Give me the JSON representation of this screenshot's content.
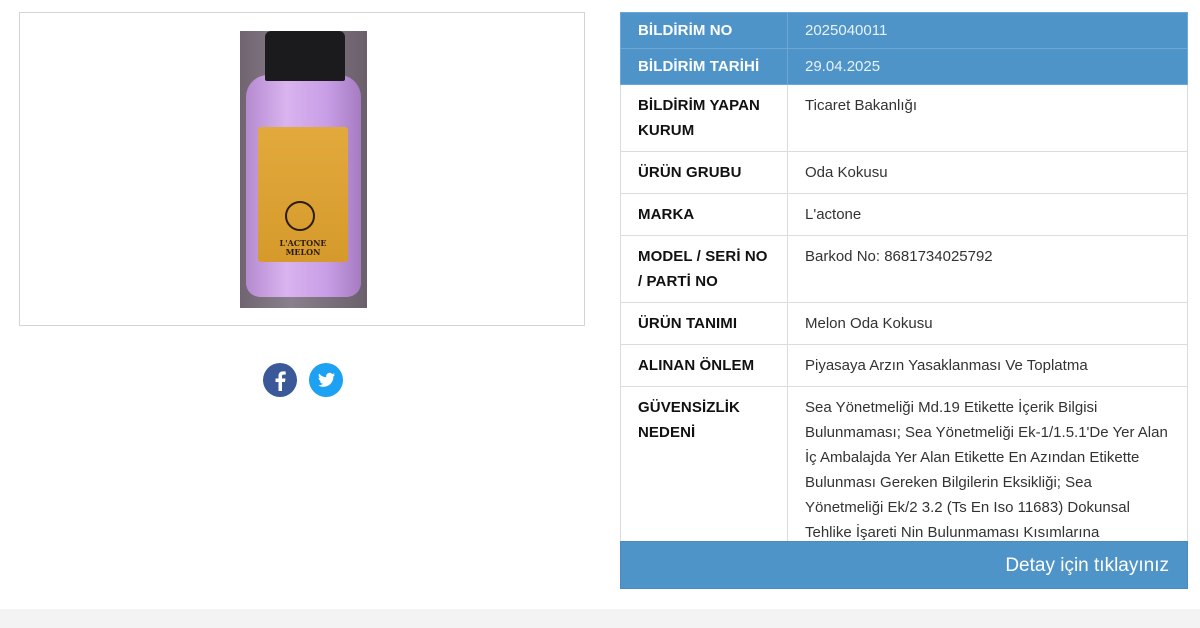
{
  "product_image": {
    "label_lines": [
      "L'ACTONE",
      "MELON"
    ]
  },
  "social": {
    "facebook_icon": "facebook-icon",
    "twitter_icon": "twitter-icon",
    "facebook_color": "#3b5998",
    "twitter_color": "#1da1f2"
  },
  "table": {
    "rows": [
      {
        "key": "BİLDİRİM NO",
        "value": "2025040011"
      },
      {
        "key": "BİLDİRİM TARİHİ",
        "value": "29.04.2025"
      },
      {
        "key": "BİLDİRİM YAPAN KURUM",
        "value": "Ticaret Bakanlığı"
      },
      {
        "key": "ÜRÜN GRUBU",
        "value": "Oda Kokusu"
      },
      {
        "key": "MARKA",
        "value": "L'actone"
      },
      {
        "key": "MODEL / SERİ NO / PARTİ NO",
        "value": "Barkod No: 8681734025792"
      },
      {
        "key": "ÜRÜN TANIMI",
        "value": "Melon Oda Kokusu"
      },
      {
        "key": "ALINAN ÖNLEM",
        "value": "Piyasaya Arzın Yasaklanması Ve Toplatma"
      },
      {
        "key": "GÜVENSİZLİK NEDENİ",
        "value": "Sea Yönetmeliği Md.19 Etikette İçerik Bilgisi Bulunmaması; Sea Yönetmeliği Ek-1/1.5.1'De Yer Alan İç Ambalajda Yer Alan Etikette En Azından Etikette Bulunması Gereken Bilgilerin Eksikliği; Sea Yönetmeliği Ek/2 3.2 (Ts En Iso 11683) Dokunsal Tehlike İşareti Nin Bulunmaması Kısımlarına Aykırılıklar Tespit Edilmiştir."
      }
    ]
  },
  "detail_button": {
    "label": "Detay için tıklayınız"
  },
  "colors": {
    "accent": "#4f94c9"
  }
}
